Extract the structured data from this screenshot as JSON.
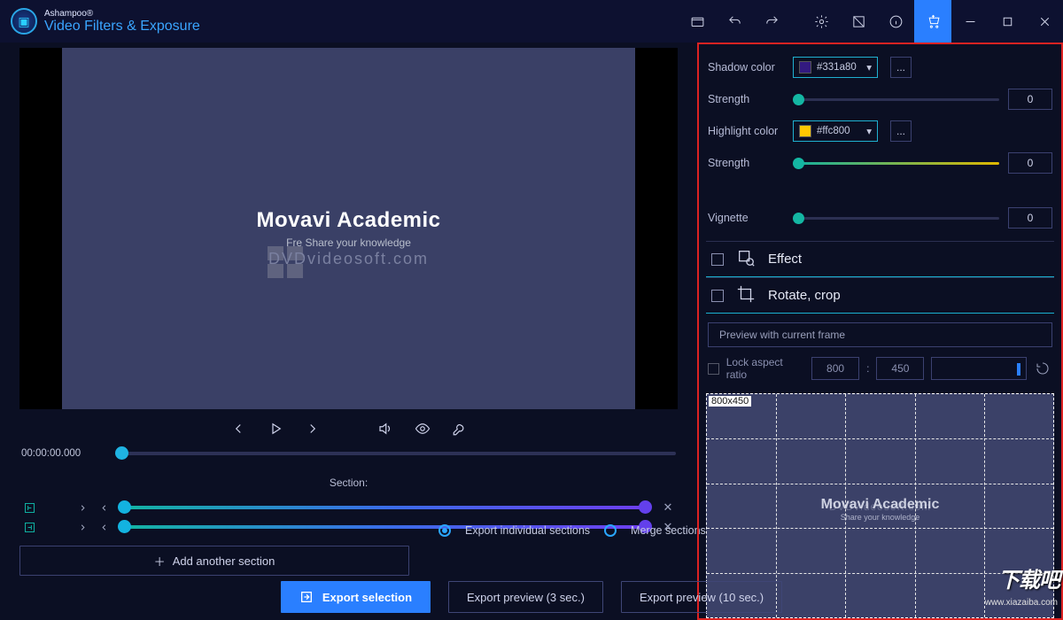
{
  "brand": {
    "small": "Ashampoo®",
    "big": "Video Filters & Exposure"
  },
  "preview": {
    "wm_title": "Movavi Academic",
    "wm_sub": "Share your knowledge",
    "wm_faded": "DVDvideosoft.com",
    "wm_prefix": "Fre"
  },
  "player": {
    "timecode": "00:00:00.000"
  },
  "section": {
    "label": "Section:",
    "add_label": "Add another section",
    "export_individual": "Export individual sections",
    "merge": "Merge sections"
  },
  "bottom": {
    "export_selection": "Export selection",
    "export_preview3": "Export preview (3 sec.)",
    "export_preview10": "Export preview (10 sec.)"
  },
  "right": {
    "shadow_color_lbl": "Shadow color",
    "shadow_color_val": "#331a80",
    "strength_lbl": "Strength",
    "strength_val": "0",
    "highlight_color_lbl": "Highlight color",
    "highlight_color_val": "#ffc800",
    "highlight_strength_val": "0",
    "vignette_lbl": "Vignette",
    "vignette_val": "0",
    "effect_lbl": "Effect",
    "rotate_lbl": "Rotate, crop",
    "preview_frame_btn": "Preview with current frame",
    "lock_aspect_lbl": "Lock aspect ratio",
    "width_val": "800",
    "height_val": "450",
    "crop_dim": "800x450"
  },
  "watermark": {
    "dl": "下载吧",
    "url": "www.xiazaiba.com"
  },
  "more_btn": "..."
}
